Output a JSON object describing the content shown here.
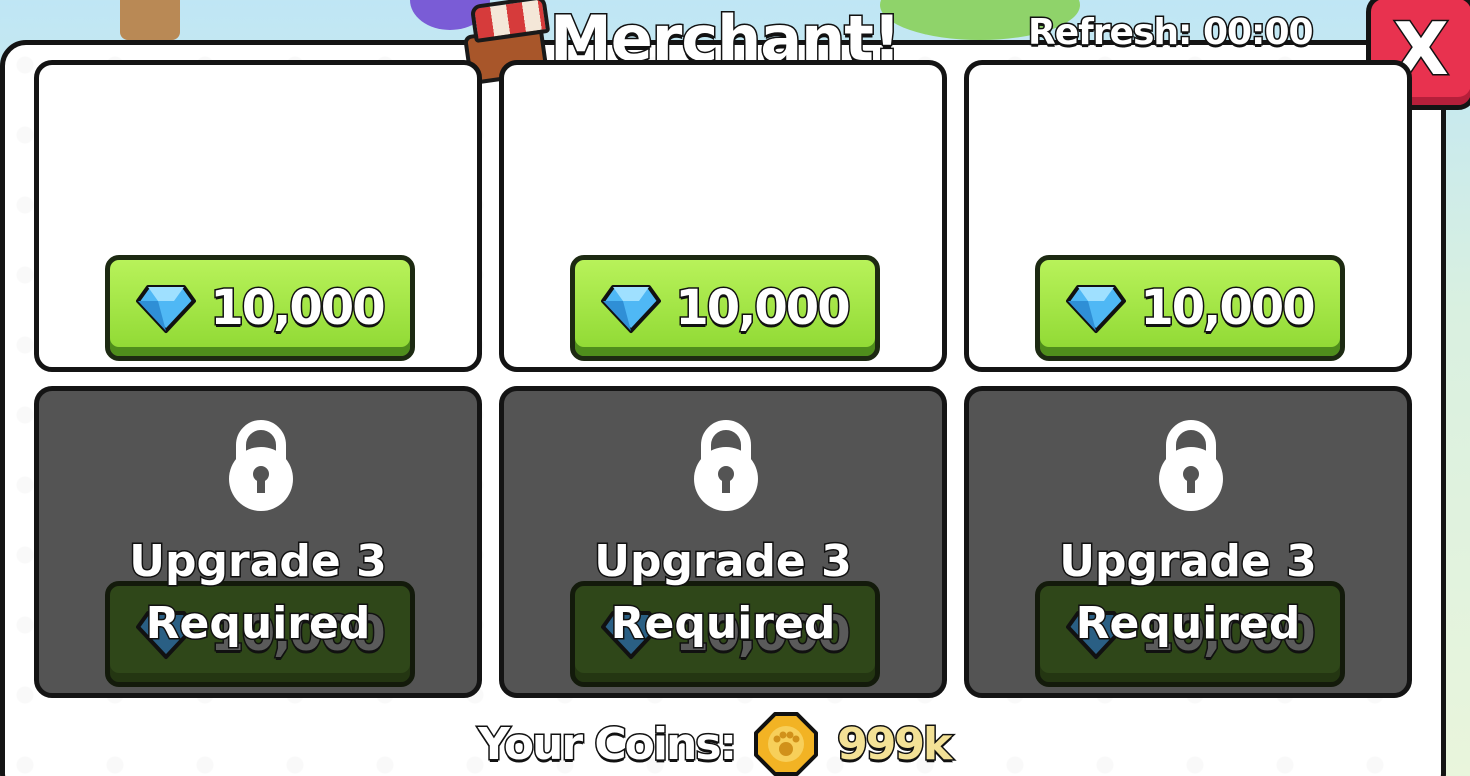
{
  "header": {
    "title": "Merchant!",
    "refresh_text": "Refresh: 00:00",
    "close_label": "X"
  },
  "slots": [
    {
      "price": "10,000",
      "currency_icon": "gem-icon",
      "locked": false
    },
    {
      "price": "10,000",
      "currency_icon": "gem-icon",
      "locked": false
    },
    {
      "price": "10,000",
      "currency_icon": "gem-icon",
      "locked": false
    },
    {
      "price": "10,000",
      "currency_icon": "gem-icon",
      "locked": true,
      "lock_line1": "Upgrade 3",
      "lock_line2": "Required"
    },
    {
      "price": "10,000",
      "currency_icon": "gem-icon",
      "locked": true,
      "lock_line1": "Upgrade 3",
      "lock_line2": "Required"
    },
    {
      "price": "10,000",
      "currency_icon": "gem-icon",
      "locked": true,
      "lock_line1": "Upgrade 3",
      "lock_line2": "Required"
    }
  ],
  "footer": {
    "coins_label": "Your Coins:",
    "coins_value": "999k",
    "coin_icon": "paw-coin-icon"
  },
  "colors": {
    "close_button": "#e8324f",
    "buy_button": "#8ed832",
    "locked_card": "#545454"
  }
}
